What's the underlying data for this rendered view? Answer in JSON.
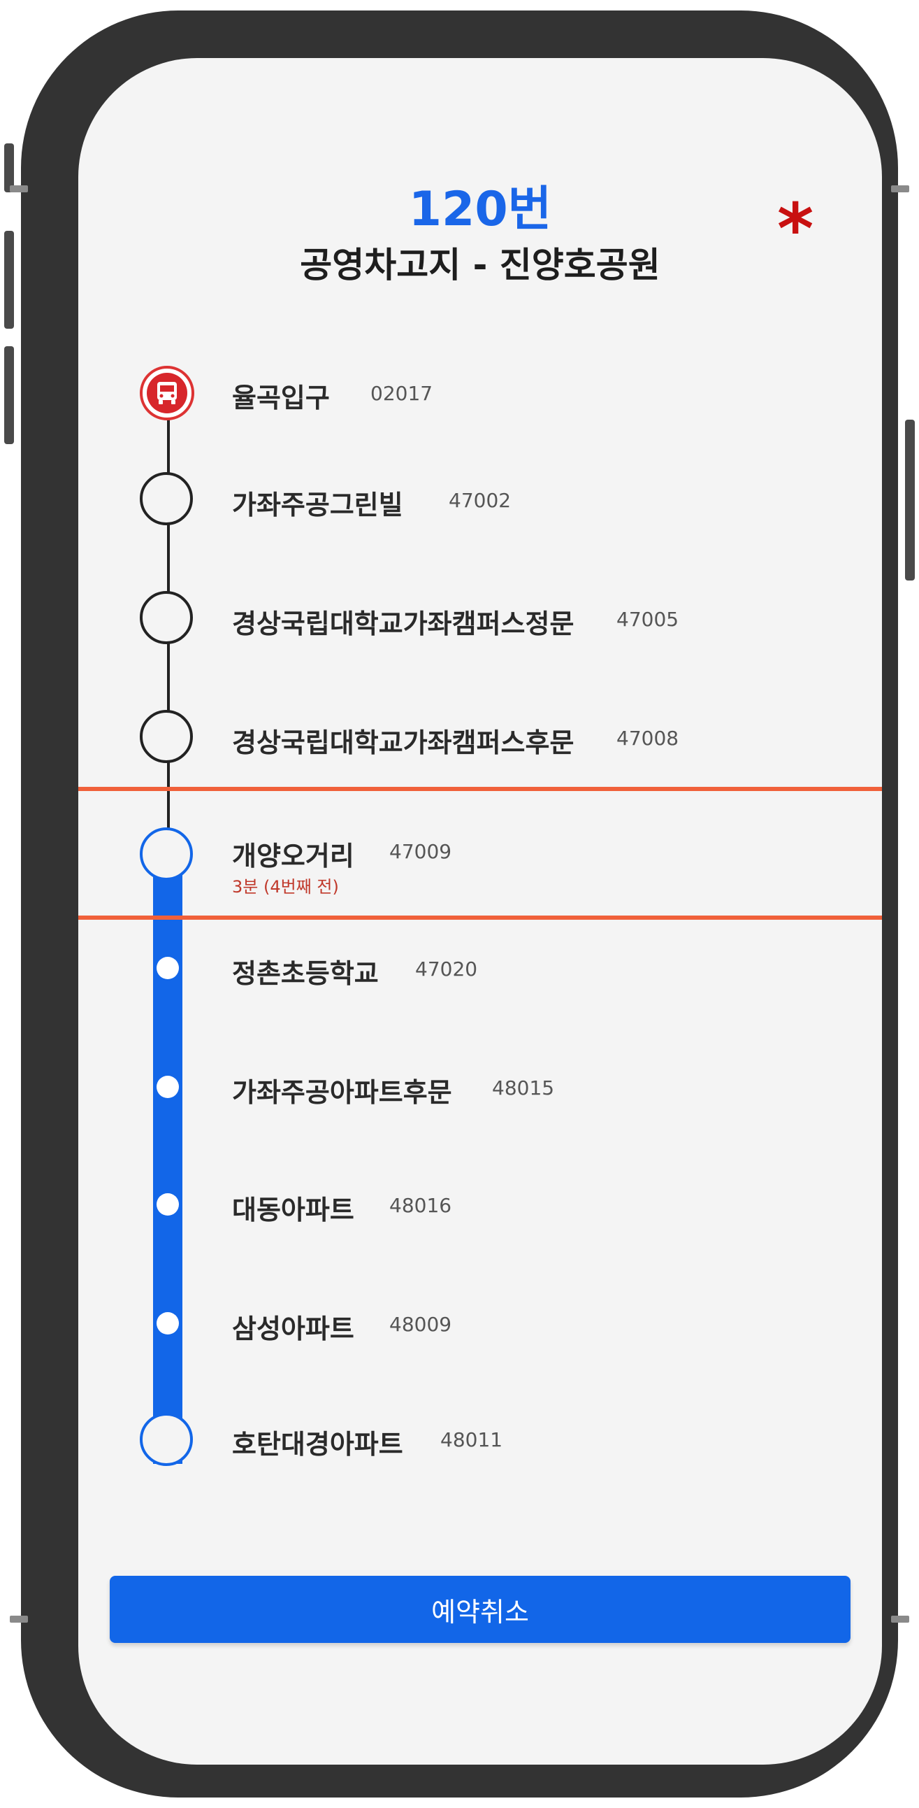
{
  "header": {
    "route_number": "120번",
    "route_name": "공영차고지 - 진양호공원",
    "favorite_symbol": "*"
  },
  "stops": [
    {
      "name": "율곡입구",
      "code": "02017"
    },
    {
      "name": "가좌주공그린빌",
      "code": "47002"
    },
    {
      "name": "경상국립대학교가좌캠퍼스정문",
      "code": "47005"
    },
    {
      "name": "경상국립대학교가좌캠퍼스후문",
      "code": "47008"
    },
    {
      "name": "개양오거리",
      "code": "47009",
      "eta": "3분 (4번째 전)"
    },
    {
      "name": "정촌초등학교",
      "code": "47020"
    },
    {
      "name": "가좌주공아파트후문",
      "code": "48015"
    },
    {
      "name": "대동아파트",
      "code": "48016"
    },
    {
      "name": "삼성아파트",
      "code": "48009"
    },
    {
      "name": "호탄대경아파트",
      "code": "48011"
    }
  ],
  "actions": {
    "cancel_label": "예약취소"
  },
  "colors": {
    "accent": "#1266e8",
    "highlight": "#f0603a",
    "bus": "#d7262b",
    "eta": "#c0392b"
  },
  "icons": {
    "current_bus": "bus-icon"
  }
}
